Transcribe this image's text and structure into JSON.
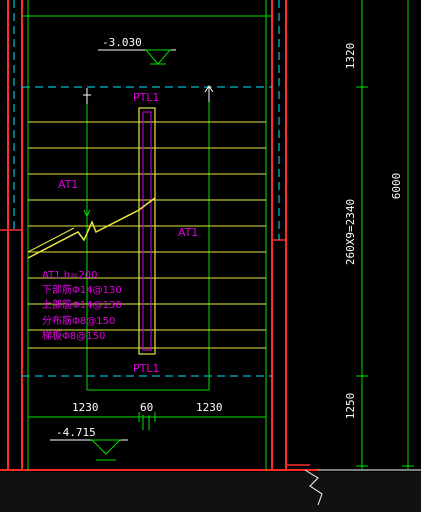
{
  "drawing": {
    "levels": {
      "top": "-3.030",
      "bottom": "-4.715"
    },
    "beams": {
      "top_label": "PTL1",
      "bottom_label": "PTL1"
    },
    "flights": {
      "left_label": "AT1",
      "right_label": "AT1"
    },
    "note_lines": [
      "AT1 h=200",
      "下部筋Φ14@130",
      "上部筋Φ14@130",
      "分布筋Φ8@150",
      "梯板Φ8@150"
    ],
    "bottom_dims": {
      "left": "1230",
      "mid": "60",
      "right": "1230"
    },
    "right_dims": {
      "top": "1320",
      "mid": "260X9=2340",
      "bottom": "1250",
      "total": "6000"
    },
    "colors": {
      "wall": "#ff2a2a",
      "grid": "#00e000",
      "axis_dash": "#00e8ff",
      "treads": "#e8e840",
      "text_mag": "#e000e0",
      "dim_text": "#ffffff"
    }
  }
}
